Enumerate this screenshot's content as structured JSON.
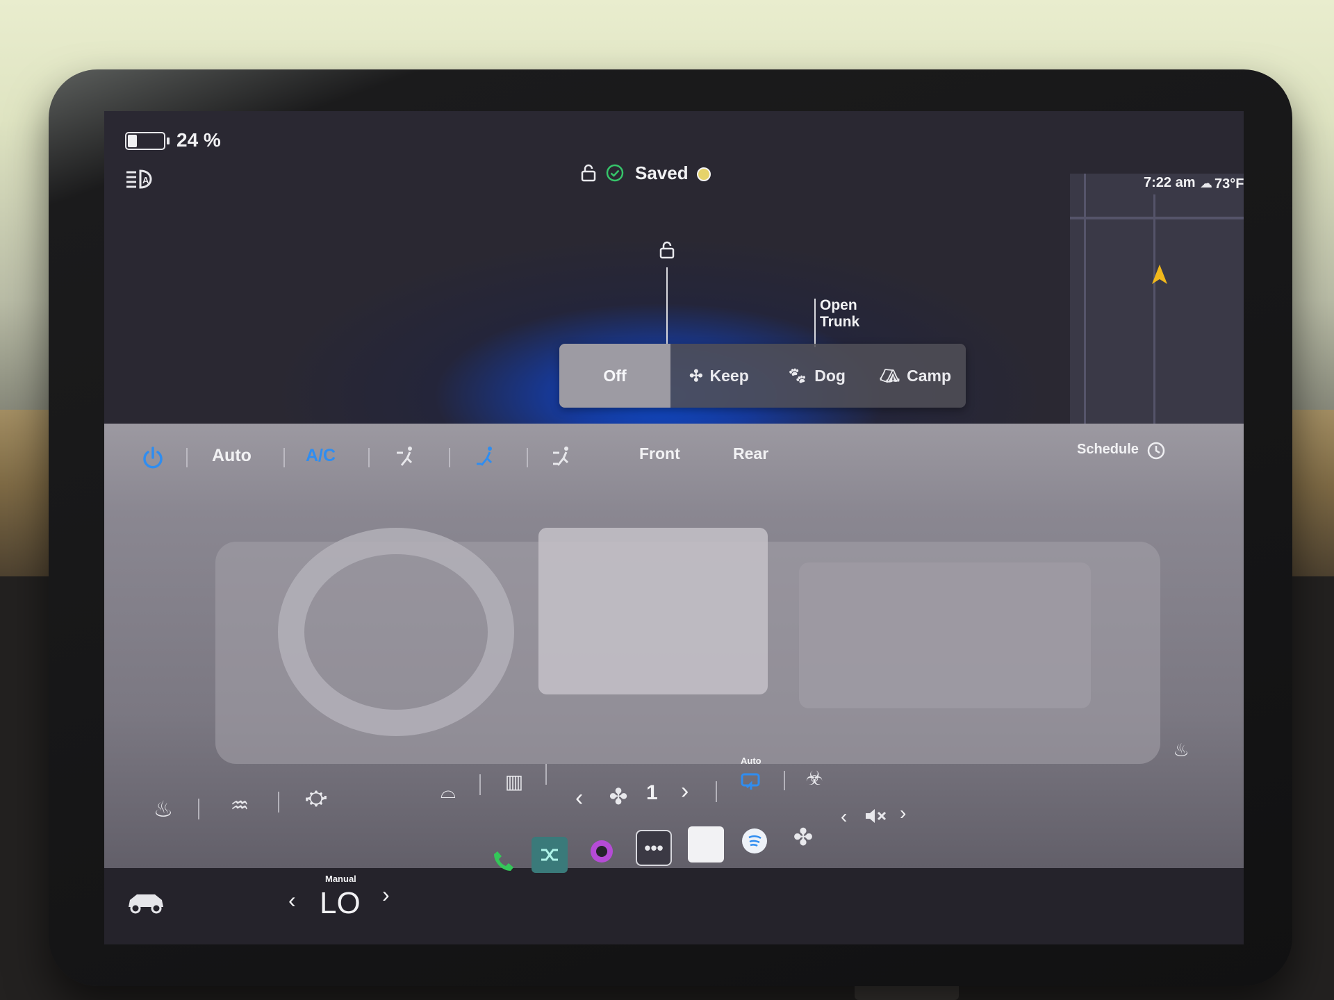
{
  "status_bar": {
    "battery_percent": "24 %",
    "battery_level": 0.24,
    "sentry_status": "Saved",
    "time": "7:22 am",
    "temperature": "73°F"
  },
  "car_view": {
    "open_trunk_line1": "Open",
    "open_trunk_line2": "Trunk"
  },
  "climate_modes": {
    "off": "Off",
    "keep": "Keep",
    "dog": "Dog",
    "camp": "Camp",
    "selected": "Off"
  },
  "climate_toolbar": {
    "auto": "Auto",
    "ac": "A/C",
    "front": "Front",
    "rear": "Rear",
    "schedule": "Schedule"
  },
  "fan": {
    "speed": "1",
    "recirc_label": "Auto"
  },
  "temperature_control": {
    "mode": "Manual",
    "value": "LO"
  },
  "colors": {
    "accent_blue": "#2f8df0",
    "call_green": "#34c759",
    "app_purple": "#b54bd6",
    "sentry_green": "#36c46a"
  },
  "icons": [
    "battery-icon",
    "auto-headlights-icon",
    "lock-icon",
    "check-icon",
    "sentry-dot-icon",
    "weather-icon",
    "navigate-icon",
    "power-icon",
    "airflow-face-icon",
    "airflow-feet-icon",
    "airflow-face-feet-icon",
    "clock-icon",
    "steering-heat-icon",
    "car-icon",
    "seat-heater-icon",
    "rear-defrost-icon",
    "wheel-heat-icon",
    "front-defrost-icon",
    "fan-icon",
    "recirc-icon",
    "bioweapon-icon",
    "phone-icon",
    "shuffle-icon",
    "camera-icon",
    "more-icon",
    "app-icon",
    "spotify-icon",
    "toybox-icon",
    "mute-icon"
  ]
}
